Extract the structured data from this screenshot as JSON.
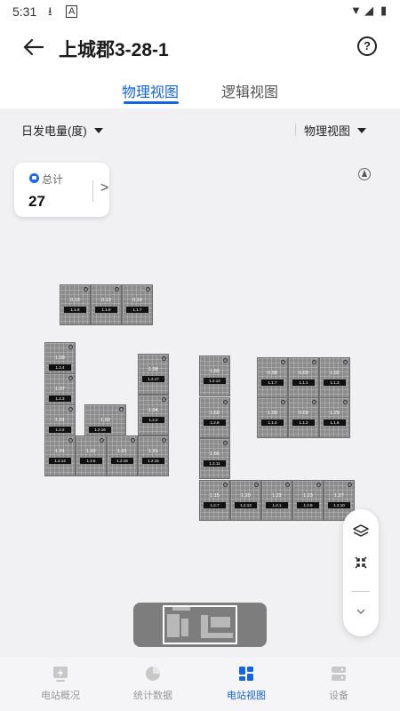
{
  "status_bar": {
    "time": "5:31"
  },
  "header": {
    "title": "上城郡3-28-1",
    "help_label": "?"
  },
  "tabs": [
    {
      "label": "物理视图",
      "active": true
    },
    {
      "label": "逻辑视图",
      "active": false
    }
  ],
  "filters": {
    "metric": "日发电量(度)",
    "view": "物理视图"
  },
  "total_card": {
    "label": "总计",
    "value": "27"
  },
  "panels": [
    {
      "value": "0.13",
      "id": "1.1.8"
    },
    {
      "value": "0.13",
      "id": "1.1.9"
    },
    {
      "value": "0.14",
      "id": "1.1.7"
    },
    {
      "value": "1.99",
      "id": "1.2.4"
    },
    {
      "value": "1.97",
      "id": "1.2.3"
    },
    {
      "value": "1.91",
      "id": "1.2.2"
    },
    {
      "value": "1.93",
      "id": "1.2.16"
    },
    {
      "value": "1.91",
      "id": "1.2.14"
    },
    {
      "value": "1.92",
      "id": "1.2.6"
    },
    {
      "value": "1.91",
      "id": "1.2.18"
    },
    {
      "value": "1.91",
      "id": "1.2.15"
    },
    {
      "value": "1.98",
      "id": "1.2.17"
    },
    {
      "value": "1.94",
      "id": "1.2.2"
    },
    {
      "value": "1.89",
      "id": "1.2.12"
    },
    {
      "value": "1.69",
      "id": "1.2.8"
    },
    {
      "value": "1.66",
      "id": "1.2.11"
    },
    {
      "value": "0.98",
      "id": "1.1.7"
    },
    {
      "value": "0.69",
      "id": "1.1.1"
    },
    {
      "value": "1.02",
      "id": "1.1.3"
    },
    {
      "value": "1.00",
      "id": "1.1.4"
    },
    {
      "value": "0.69",
      "id": "1.1.2"
    },
    {
      "value": "1.29",
      "id": "1.1.6"
    },
    {
      "value": "1.15",
      "id": "1.2.7"
    },
    {
      "value": "1.20",
      "id": "1.2.13"
    },
    {
      "value": "1.22",
      "id": "1.2.1"
    },
    {
      "value": "1.23",
      "id": "1.2.9"
    },
    {
      "value": "1.27",
      "id": "1.2.10"
    }
  ],
  "bottom_nav": [
    {
      "label": "电站概况",
      "icon": "lightning-icon",
      "active": false
    },
    {
      "label": "统计数据",
      "icon": "pie-chart-icon",
      "active": false
    },
    {
      "label": "电站视图",
      "icon": "grid-view-icon",
      "active": true
    },
    {
      "label": "设备",
      "icon": "device-icon",
      "active": false
    }
  ],
  "colors": {
    "accent": "#1565e0",
    "panel": "#8b8b8b",
    "background": "#f1f1f3"
  }
}
